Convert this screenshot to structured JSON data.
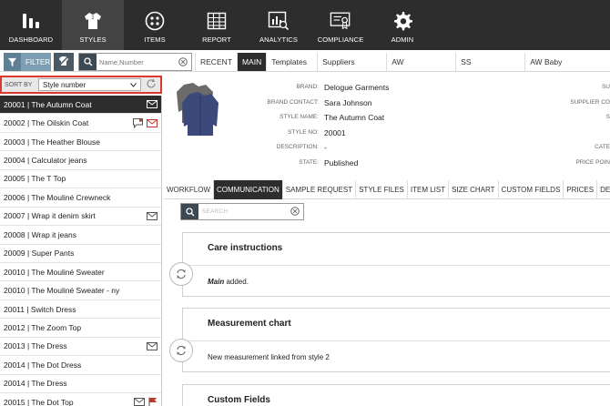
{
  "nav": [
    {
      "label": "DASHBOARD",
      "icon": "bar-chart-icon",
      "active": false
    },
    {
      "label": "STYLES",
      "icon": "shirt-icon",
      "active": true
    },
    {
      "label": "ITEMS",
      "icon": "buttons-icon",
      "active": false
    },
    {
      "label": "REPORT",
      "icon": "table-icon",
      "active": false
    },
    {
      "label": "ANALYTICS",
      "icon": "analytics-icon",
      "active": false
    },
    {
      "label": "COMPLIANCE",
      "icon": "certificate-icon",
      "active": false
    },
    {
      "label": "ADMIN",
      "icon": "gear-icon",
      "active": false
    }
  ],
  "toolbar": {
    "filter_label": "FILTER",
    "search_placeholder": "Name,Number",
    "tabs": [
      {
        "label": "RECENT",
        "active": false
      },
      {
        "label": "MAIN",
        "active": true
      },
      {
        "label": "Templates",
        "active": false
      },
      {
        "label": "Suppliers",
        "active": false
      },
      {
        "label": "AW",
        "active": false
      },
      {
        "label": "SS",
        "active": false
      },
      {
        "label": "AW Baby",
        "active": false
      }
    ]
  },
  "sort": {
    "label": "SORT BY",
    "value": "Style number"
  },
  "styles": [
    {
      "text": "20001 | The Autumn Coat",
      "active": true,
      "icons": [
        "envelope-icon"
      ]
    },
    {
      "text": "20002 | The Oilskin Coat",
      "active": false,
      "icons": [
        "comment-icon",
        "envelope-red-icon"
      ]
    },
    {
      "text": "20003 | The Heather Blouse",
      "active": false,
      "icons": []
    },
    {
      "text": "20004 | Calculator jeans",
      "active": false,
      "icons": []
    },
    {
      "text": "20005 | The T Top",
      "active": false,
      "icons": []
    },
    {
      "text": "20006 | The Mouliné Crewneck",
      "active": false,
      "icons": []
    },
    {
      "text": "20007 | Wrap it denim skirt",
      "active": false,
      "icons": [
        "envelope-icon"
      ]
    },
    {
      "text": "20008 | Wrap it jeans",
      "active": false,
      "icons": []
    },
    {
      "text": "20009 | Super Pants",
      "active": false,
      "icons": []
    },
    {
      "text": "20010 | The Mouliné Sweater",
      "active": false,
      "icons": []
    },
    {
      "text": "20010 | The Mouliné Sweater - ny",
      "active": false,
      "icons": []
    },
    {
      "text": "20011 | Switch Dress",
      "active": false,
      "icons": []
    },
    {
      "text": "20012 | The Zoom Top",
      "active": false,
      "icons": []
    },
    {
      "text": "20013 | The Dress",
      "active": false,
      "icons": [
        "envelope-icon"
      ]
    },
    {
      "text": "20014 | The Dot Dress",
      "active": false,
      "icons": []
    },
    {
      "text": "20014 | The Dress",
      "active": false,
      "icons": []
    },
    {
      "text": "20015 | The Dot Top",
      "active": false,
      "icons": [
        "envelope-icon",
        "flag-icon"
      ]
    }
  ],
  "details": {
    "fields": [
      {
        "label": "BRAND:",
        "value": "Delogue Garments"
      },
      {
        "label": "BRAND CONTACT:",
        "value": "Sara Johnson"
      },
      {
        "label": "STYLE NAME:",
        "value": "The Autumn Coat"
      },
      {
        "label": "STYLE NO:",
        "value": "20001"
      },
      {
        "label": "DESCRIPTION:",
        "value": "-"
      },
      {
        "label": "STATE:",
        "value": "Published"
      }
    ],
    "right_labels": [
      "SU",
      "SUPPLIER CO",
      "S",
      "",
      "CATE",
      "PRICE POIN"
    ]
  },
  "detail_tabs": [
    {
      "label": "WORKFLOW",
      "active": false
    },
    {
      "label": "COMMUNICATION",
      "active": true
    },
    {
      "label": "SAMPLE REQUEST",
      "active": false
    },
    {
      "label": "STYLE FILES",
      "active": false
    },
    {
      "label": "ITEM LIST",
      "active": false
    },
    {
      "label": "SIZE CHART",
      "active": false
    },
    {
      "label": "CUSTOM FIELDS",
      "active": false
    },
    {
      "label": "PRICES",
      "active": false
    },
    {
      "label": "DESC",
      "active": false
    }
  ],
  "comm_search_placeholder": "SEARCH",
  "cards": [
    {
      "title": "Care instructions",
      "body_em": "Main",
      "body": " added."
    },
    {
      "title": "Measurement chart",
      "body_em": "",
      "body": "New measurement linked from style 2"
    },
    {
      "title": "Custom Fields",
      "body_em": "",
      "body": ""
    }
  ],
  "colors": {
    "nav_bg": "#2d2d2d",
    "highlight": "#d93a2b",
    "filter": "#7e9fb3"
  }
}
